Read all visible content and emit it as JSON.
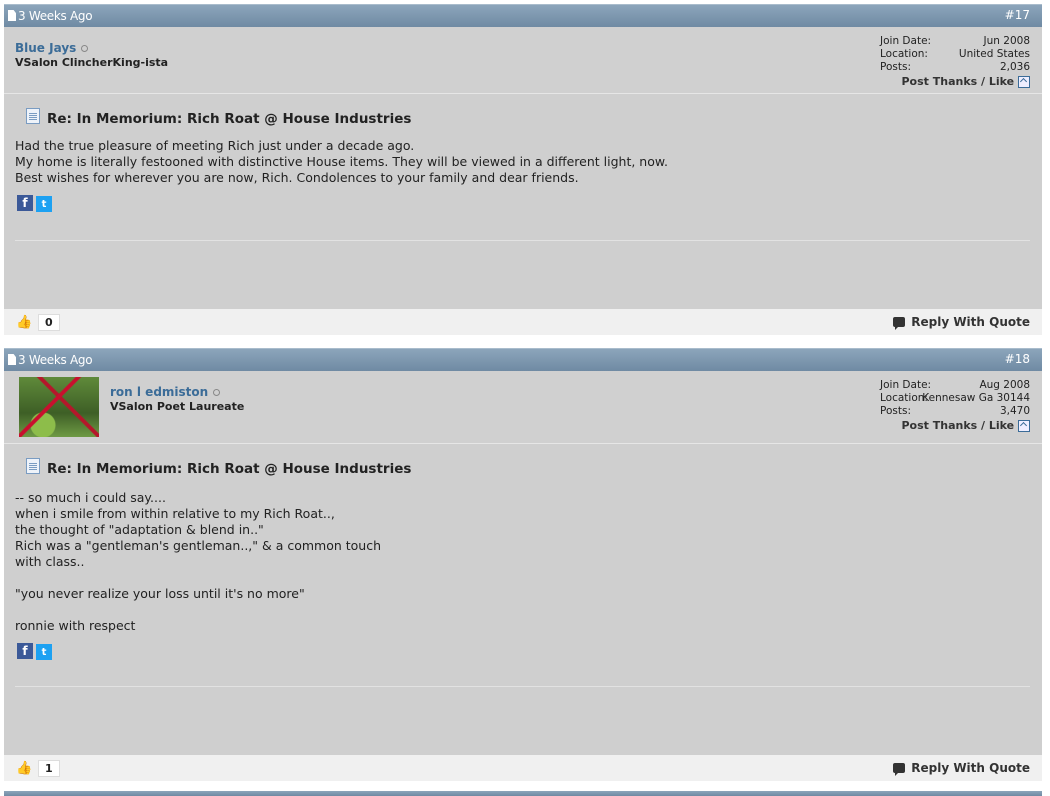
{
  "posts": [
    {
      "date": "3 Weeks Ago",
      "number": "#17",
      "username": "Blue Jays",
      "usertitle": "VSalon ClincherKing-ista",
      "info": {
        "join_label": "Join Date:",
        "join_value": "Jun 2008",
        "location_label": "Location:",
        "location_value": "United States",
        "posts_label": "Posts:",
        "posts_value": "2,036"
      },
      "thanks_label": "Post Thanks / Like",
      "title": "Re: In Memorium: Rich Roat @ House Industries",
      "lines": [
        "Had the true pleasure of meeting Rich just under a decade ago.",
        "My home is literally festooned with distinctive House items. They will be viewed in a different light, now.",
        "Best wishes for wherever you are now, Rich. Condolences to your family and dear friends."
      ],
      "like_count": "0",
      "reply_label": "Reply With Quote"
    },
    {
      "date": "3 Weeks Ago",
      "number": "#18",
      "username": "ron l edmiston",
      "usertitle": "VSalon Poet Laureate",
      "info": {
        "join_label": "Join Date:",
        "join_value": "Aug 2008",
        "location_label": "Location:",
        "location_value": "Kennesaw Ga 30144",
        "posts_label": "Posts:",
        "posts_value": "3,470"
      },
      "thanks_label": "Post Thanks / Like",
      "title": "Re: In Memorium: Rich Roat @ House Industries",
      "lines": [
        "-- so much i could say....",
        "when i smile from within relative to my Rich Roat..,",
        "the thought of \"adaptation & blend in..\"",
        "Rich was a \"gentleman's gentleman..,\" & a common touch",
        "with class..",
        "",
        "\"you never realize your loss until it's no more\"",
        "",
        "ronnie with respect"
      ],
      "like_count": "1",
      "reply_label": "Reply With Quote"
    }
  ]
}
